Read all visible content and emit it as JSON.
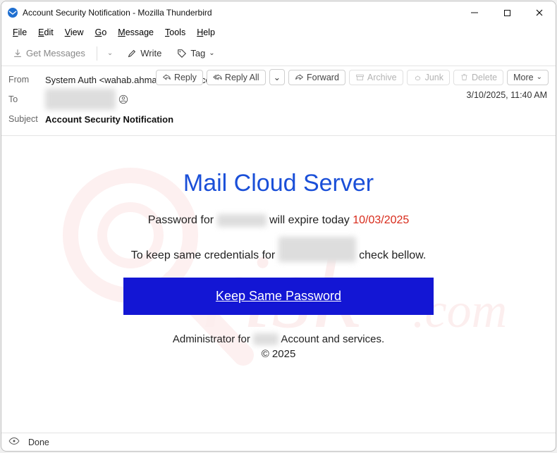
{
  "window": {
    "title": "Account Security Notification - Mozilla Thunderbird"
  },
  "menu": {
    "file": "File",
    "edit": "Edit",
    "view": "View",
    "go": "Go",
    "message": "Message",
    "tools": "Tools",
    "help": "Help"
  },
  "toolbar": {
    "get_messages": "Get Messages",
    "write": "Write",
    "tag": "Tag"
  },
  "headers": {
    "from_label": "From",
    "from_value": "System Auth <wahab.ahmad@qrilabs.com>",
    "to_label": "To",
    "to_value_redacted": "redacted recipient",
    "subject_label": "Subject",
    "subject_value": "Account Security Notification",
    "date": "3/10/2025, 11:40 AM"
  },
  "actions": {
    "reply": "Reply",
    "reply_all": "Reply All",
    "forward": "Forward",
    "archive": "Archive",
    "junk": "Junk",
    "delete": "Delete",
    "more": "More"
  },
  "mail": {
    "title": "Mail Cloud Server",
    "line1_pre": "Password for ",
    "line1_redacted": "redacted",
    "line1_mid": " will expire today ",
    "line1_date": "10/03/2025",
    "line2_pre": "To keep same credentials for ",
    "line2_redacted": "redacted domain",
    "line2_post": " check bellow.",
    "cta": "Keep Same Password",
    "foot_pre": "Administrator for ",
    "foot_redacted": "red",
    "foot_post": " Account and services.",
    "copyright": "© 2025"
  },
  "status": {
    "done": "Done"
  }
}
